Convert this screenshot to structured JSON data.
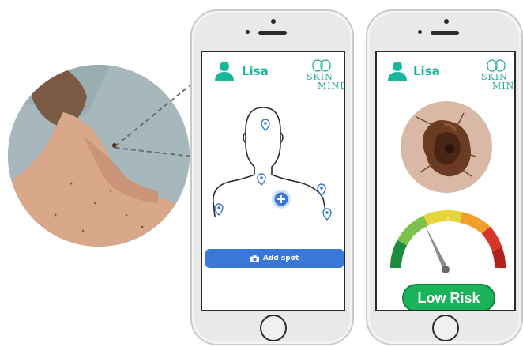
{
  "screen_left": {
    "user": {
      "name": "Lisa",
      "avatar_icon": "user-icon"
    },
    "logo": {
      "line1": "SKIN",
      "line2": "MIND"
    },
    "body_map": {
      "markers": [
        "head-spot",
        "neck-spot",
        "right-shoulder-spot",
        "left-shoulder-spot",
        "far-right-spot"
      ],
      "add_icon": "plus-icon"
    },
    "add_spot_button": {
      "label": "Add spot",
      "icon": "camera-icon"
    }
  },
  "screen_right": {
    "user": {
      "name": "Lisa",
      "avatar_icon": "user-icon"
    },
    "logo": {
      "line1": "SKIN",
      "line2": "MIND"
    },
    "gauge": {
      "level": 0.3,
      "colors": [
        "#1e8a3c",
        "#7cc24a",
        "#e6d43a",
        "#f0a02a",
        "#d9352a",
        "#b1201c"
      ]
    },
    "risk_button": {
      "label": "Low Risk"
    }
  },
  "colors": {
    "accent": "#18b79a",
    "button_blue": "#3a78d8",
    "risk_green": "#19b35a"
  }
}
